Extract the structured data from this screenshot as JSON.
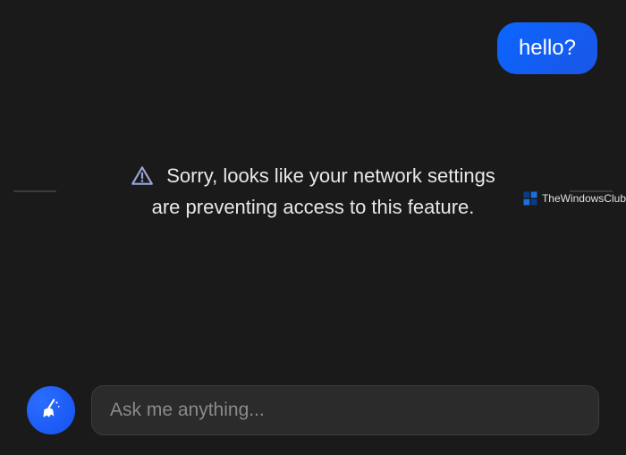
{
  "chat": {
    "user_message": "hello?",
    "error_line1": "Sorry, looks like your network settings",
    "error_line2": "are preventing access to this feature."
  },
  "input": {
    "placeholder": "Ask me anything...",
    "value": ""
  },
  "watermark": {
    "text": "TheWindowsClub"
  },
  "icons": {
    "warning": "warning-icon",
    "broom": "broom-icon",
    "watermark_logo": "windows-club-logo"
  },
  "colors": {
    "background": "#1a1a1a",
    "bubble_blue": "#1b56e6",
    "accent_blue": "#1452f0",
    "text": "#e8e8e8",
    "placeholder": "#8a8a8a"
  }
}
